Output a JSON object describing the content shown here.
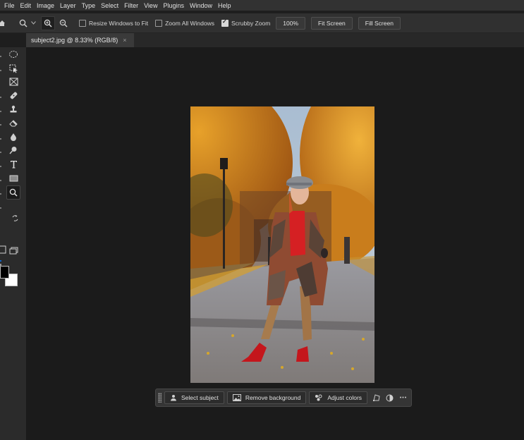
{
  "menu": [
    "File",
    "Edit",
    "Image",
    "Layer",
    "Type",
    "Select",
    "Filter",
    "View",
    "Plugins",
    "Window",
    "Help"
  ],
  "options": {
    "resize_windows_label": "Resize Windows to Fit",
    "resize_windows_checked": false,
    "zoom_all_label": "Zoom All Windows",
    "zoom_all_checked": false,
    "scrubby_zoom_label": "Scrubby Zoom",
    "scrubby_zoom_checked": true,
    "zoom_value": "100%",
    "fit_screen_label": "Fit Screen",
    "fill_screen_label": "Fill Screen"
  },
  "document_tab": {
    "title": "subject2.jpg @ 8.33% (RGB/8)",
    "close_glyph": "×"
  },
  "contextual_taskbar": {
    "select_subject_label": "Select subject",
    "remove_background_label": "Remove background",
    "adjust_colors_label": "Adjust colors",
    "more_glyph": "•••"
  },
  "tools": [
    "elliptical-marquee",
    "object-selection",
    "frame",
    "spot-healing-brush",
    "clone-stamp",
    "eraser",
    "blur",
    "dodge",
    "type",
    "rectangle",
    "zoom"
  ],
  "colors": {
    "foreground": "#000000",
    "background": "#ffffff",
    "accent": "#0d66d0"
  }
}
